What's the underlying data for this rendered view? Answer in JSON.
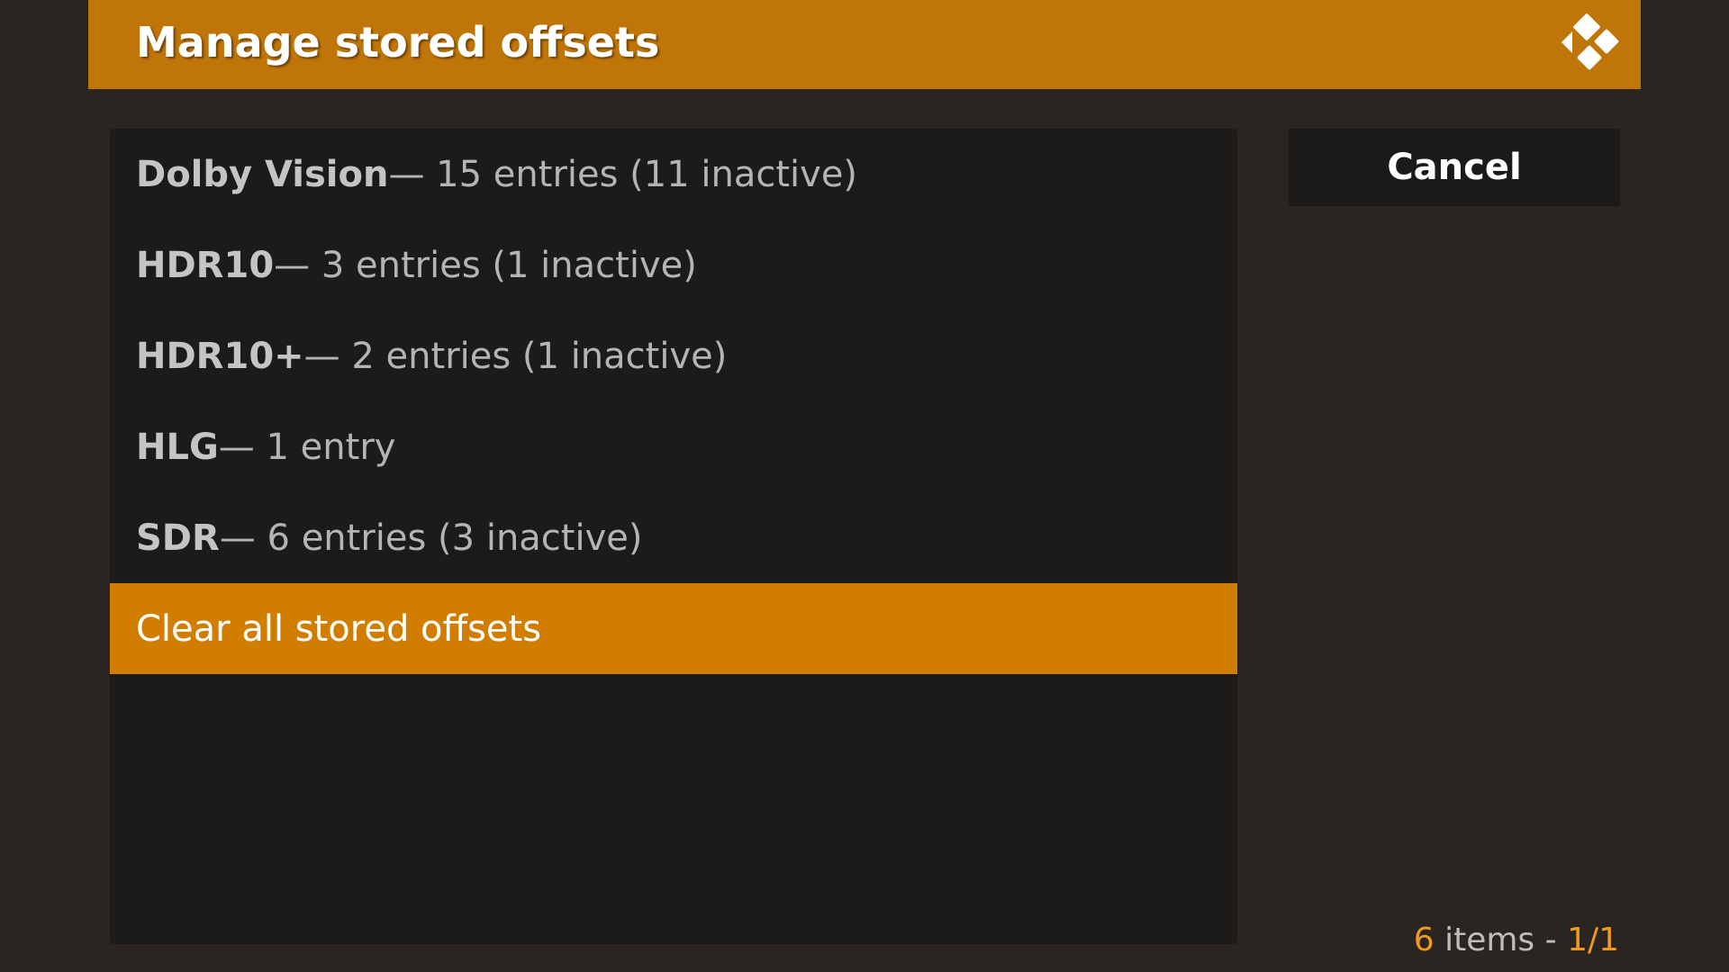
{
  "dialog": {
    "title": "Manage stored offsets"
  },
  "list": {
    "items": [
      {
        "name": "Dolby Vision",
        "detail": " — 15 entries (11 inactive)"
      },
      {
        "name": "HDR10",
        "detail": " — 3 entries (1 inactive)"
      },
      {
        "name": "HDR10+",
        "detail": " — 2 entries (1 inactive)"
      },
      {
        "name": "HLG",
        "detail": " — 1 entry"
      },
      {
        "name": "SDR",
        "detail": " — 6 entries (3 inactive)"
      }
    ],
    "clear_all_label": "Clear all stored offsets"
  },
  "buttons": {
    "cancel_label": "Cancel"
  },
  "footer": {
    "count": "6",
    "items_text": " items - ",
    "page": "1/1"
  },
  "colors": {
    "accent": "#c07508",
    "selected": "#d17d00",
    "background": "#2a2521",
    "panel": "#1d1b19",
    "footer_accent": "#f09a1f"
  },
  "icons": {
    "logo": "kodi-logo-icon"
  }
}
